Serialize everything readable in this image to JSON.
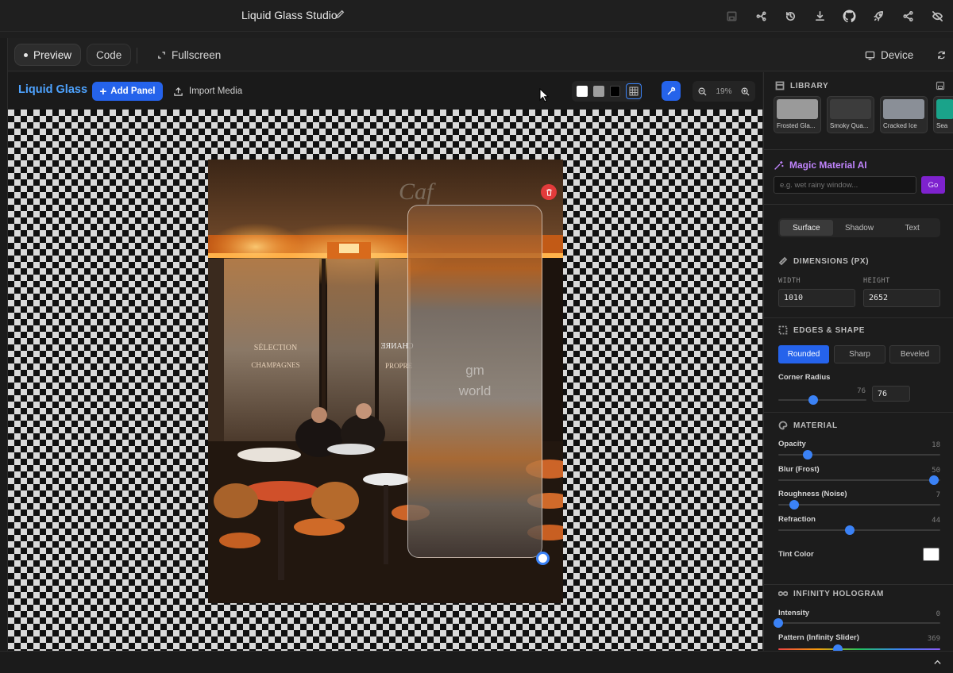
{
  "app": {
    "title": "Liquid Glass Studio"
  },
  "toolbar": {
    "preview_label": "Preview",
    "code_label": "Code",
    "fullscreen_label": "Fullscreen",
    "device_label": "Device"
  },
  "canvas_header": {
    "brand": "Liquid Glass",
    "add_panel_label": "Add Panel",
    "import_label": "Import Media",
    "zoom_label": "19%",
    "bg_swatches": [
      "#ffffff",
      "#9e9e9e",
      "#000000"
    ]
  },
  "glass_panel": {
    "line1": "gm",
    "line2": "world"
  },
  "library": {
    "title": "LIBRARY",
    "items": [
      {
        "label": "Frosted Gla...",
        "color": "#9a9a9a"
      },
      {
        "label": "Smoky Qua...",
        "color": "#3c3c3c"
      },
      {
        "label": "Cracked Ice",
        "color": "#8a8f97"
      },
      {
        "label": "Sea",
        "color": "#1aa38a"
      }
    ]
  },
  "magic": {
    "title": "Magic Material AI",
    "placeholder": "e.g. wet rainy window...",
    "go_label": "Go"
  },
  "tabs": [
    "Surface",
    "Shadow",
    "Text"
  ],
  "dimensions": {
    "title": "DIMENSIONS (PX)",
    "width_label": "WIDTH",
    "height_label": "HEIGHT",
    "width": "1010",
    "height": "2652"
  },
  "edges": {
    "title": "EDGES & SHAPE",
    "options": [
      "Rounded",
      "Sharp",
      "Beveled"
    ],
    "corner_radius_label": "Corner Radius",
    "corner_radius_value": "76",
    "corner_radius_box": "76"
  },
  "material": {
    "title": "MATERIAL",
    "opacity_label": "Opacity",
    "opacity": "18",
    "blur_label": "Blur (Frost)",
    "blur": "50",
    "roughness_label": "Roughness (Noise)",
    "roughness": "7",
    "refraction_label": "Refraction",
    "refraction": "44",
    "tint_label": "Tint Color",
    "tint_color": "#ffffff"
  },
  "hologram": {
    "title": "INFINITY HOLOGRAM",
    "intensity_label": "Intensity",
    "intensity": "0",
    "pattern_label": "Pattern (Infinity Slider)",
    "pattern": "369"
  },
  "sliders": {
    "corner_radius": 0.4,
    "opacity": 0.18,
    "blur": 0.96,
    "roughness": 0.1,
    "refraction": 0.44,
    "intensity": 0.0,
    "pattern": 0.37
  }
}
